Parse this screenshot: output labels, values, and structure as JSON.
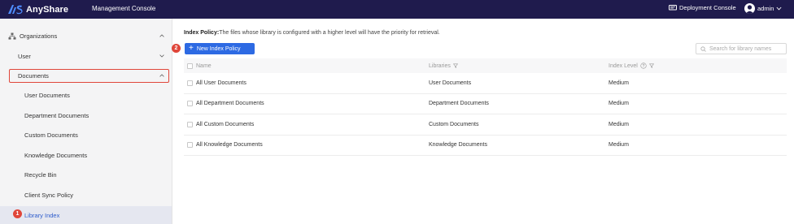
{
  "header": {
    "brand": "AnyShare",
    "console_title": "Management Console",
    "deployment_console": "Deployment Console",
    "user_name": "admin",
    "bg_color": "#1f1b4d"
  },
  "sidebar": {
    "organizations": "Organizations",
    "user": "User",
    "documents": "Documents",
    "items": [
      {
        "label": "User Documents"
      },
      {
        "label": "Department Documents"
      },
      {
        "label": "Custom Documents"
      },
      {
        "label": "Knowledge Documents"
      },
      {
        "label": "Recycle Bin"
      },
      {
        "label": "Client Sync Policy"
      },
      {
        "label": "Library Index"
      }
    ],
    "active_item": "Library Index"
  },
  "annotations": {
    "badge_1": "1",
    "badge_2": "2",
    "highlight_color": "#e0463a"
  },
  "main": {
    "policy_label": "Index Policy:",
    "policy_text": "The files whose library is configured with a higher level will have the priority for retrieval.",
    "new_button": "New Index Policy",
    "search_placeholder": "Search for library names",
    "columns": {
      "name": "Name",
      "libraries": "Libraries",
      "index_level": "Index Level"
    },
    "rows": [
      {
        "name": "All User Documents",
        "library": "User Documents",
        "level": "Medium"
      },
      {
        "name": "All Department Documents",
        "library": "Department Documents",
        "level": "Medium"
      },
      {
        "name": "All Custom Documents",
        "library": "Custom Documents",
        "level": "Medium"
      },
      {
        "name": "All Knowledge Documents",
        "library": "Knowledge Documents",
        "level": "Medium"
      }
    ],
    "accent_color": "#2d6ae3"
  }
}
